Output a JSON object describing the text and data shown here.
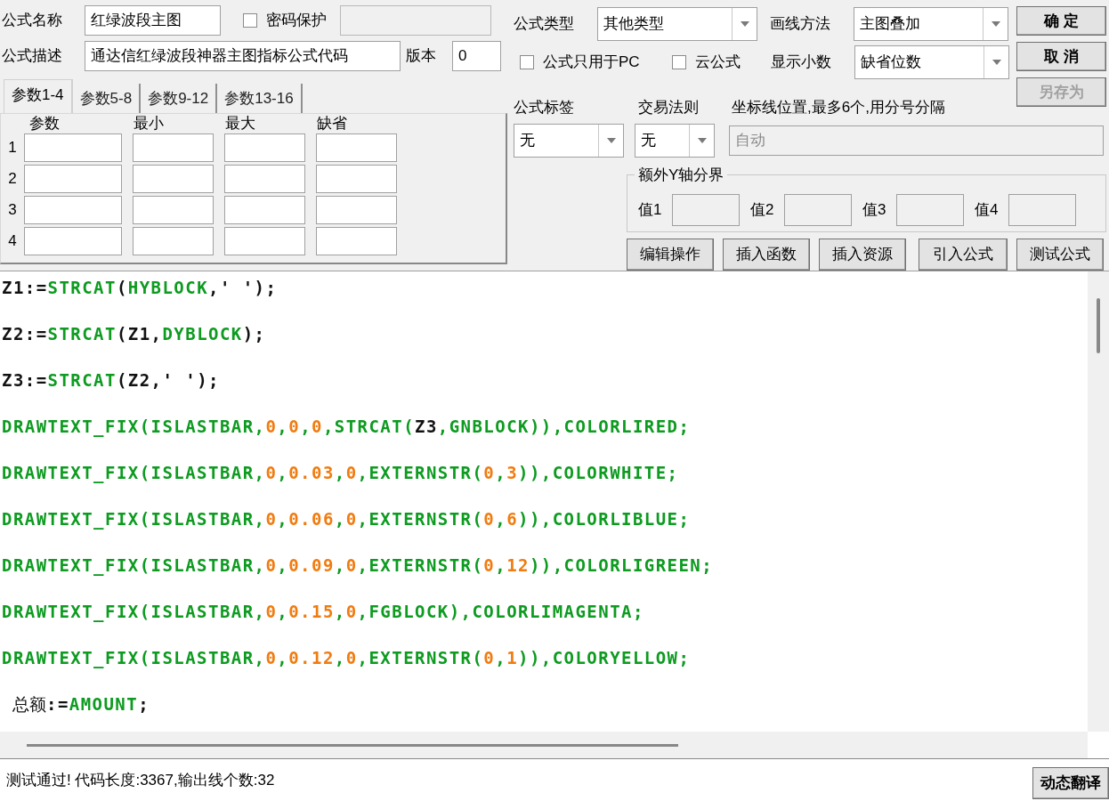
{
  "form": {
    "name_label": "公式名称",
    "name_value": "红绿波段主图",
    "password": {
      "label": "密码保护",
      "checked": false
    },
    "desc_label": "公式描述",
    "desc_value": "通达信红绿波段神器主图指标公式代码",
    "version_label": "版本",
    "version_value": "0"
  },
  "param_tabs": [
    {
      "label": "参数1-4",
      "selected": true
    },
    {
      "label": "参数5-8",
      "selected": false
    },
    {
      "label": "参数9-12",
      "selected": false
    },
    {
      "label": "参数13-16",
      "selected": false
    }
  ],
  "param_columns": [
    "参数",
    "最小",
    "最大",
    "缺省"
  ],
  "param_rows": [
    "1",
    "2",
    "3",
    "4"
  ],
  "formula_type": {
    "label": "公式类型",
    "value": "其他类型"
  },
  "draw_method": {
    "label": "画线方法",
    "value": "主图叠加"
  },
  "options": [
    {
      "label": "公式只用于PC",
      "checked": false
    },
    {
      "label": "云公式",
      "checked": false
    }
  ],
  "decimals": {
    "label": "显示小数",
    "value": "缺省位数"
  },
  "side_buttons": [
    {
      "label": "确 定",
      "disabled": false
    },
    {
      "label": "取 消",
      "disabled": false
    },
    {
      "label": "另存为",
      "disabled": true
    }
  ],
  "tag": {
    "label": "公式标签",
    "value": "无"
  },
  "rule": {
    "label": "交易法则",
    "value": "无"
  },
  "axis": {
    "label": "坐标线位置,最多6个,用分号分隔",
    "value": "自动",
    "disabled": true
  },
  "y_bounds": {
    "title": "额外Y轴分界",
    "values": [
      "值1",
      "值2",
      "值3",
      "值4"
    ]
  },
  "action_buttons": [
    "编辑操作",
    "插入函数",
    "插入资源",
    "引入公式",
    "测试公式"
  ],
  "code_lines": [
    [
      {
        "t": "Z1:=",
        "kind": "plain"
      },
      {
        "t": "STRCAT",
        "kind": "func"
      },
      {
        "t": "(",
        "kind": "plain"
      },
      {
        "t": "HYBLOCK",
        "kind": "func"
      },
      {
        "t": ",' ');",
        "kind": "plain"
      }
    ],
    [
      {
        "t": "Z2:=",
        "kind": "plain"
      },
      {
        "t": "STRCAT",
        "kind": "func"
      },
      {
        "t": "(Z1,",
        "kind": "plain"
      },
      {
        "t": "DYBLOCK",
        "kind": "func"
      },
      {
        "t": ");",
        "kind": "plain"
      }
    ],
    [
      {
        "t": "Z3:=",
        "kind": "plain"
      },
      {
        "t": "STRCAT",
        "kind": "func"
      },
      {
        "t": "(Z2,' ');",
        "kind": "plain"
      }
    ],
    [
      {
        "t": "DRAWTEXT_FIX(ISLASTBAR,",
        "kind": "func"
      },
      {
        "t": "0",
        "kind": "num"
      },
      {
        "t": ",",
        "kind": "func"
      },
      {
        "t": "0",
        "kind": "num"
      },
      {
        "t": ",",
        "kind": "func"
      },
      {
        "t": "0",
        "kind": "num"
      },
      {
        "t": ",STRCAT(",
        "kind": "func"
      },
      {
        "t": "Z3",
        "kind": "plain"
      },
      {
        "t": ",GNBLOCK)),COLORLIRED;",
        "kind": "func"
      }
    ],
    [
      {
        "t": "DRAWTEXT_FIX(ISLASTBAR,",
        "kind": "func"
      },
      {
        "t": "0",
        "kind": "num"
      },
      {
        "t": ",",
        "kind": "func"
      },
      {
        "t": "0.03",
        "kind": "num"
      },
      {
        "t": ",",
        "kind": "func"
      },
      {
        "t": "0",
        "kind": "num"
      },
      {
        "t": ",EXTERNSTR(",
        "kind": "func"
      },
      {
        "t": "0",
        "kind": "num"
      },
      {
        "t": ",",
        "kind": "func"
      },
      {
        "t": "3",
        "kind": "num"
      },
      {
        "t": ")),COLORWHITE;",
        "kind": "func"
      }
    ],
    [
      {
        "t": "DRAWTEXT_FIX(ISLASTBAR,",
        "kind": "func"
      },
      {
        "t": "0",
        "kind": "num"
      },
      {
        "t": ",",
        "kind": "func"
      },
      {
        "t": "0.06",
        "kind": "num"
      },
      {
        "t": ",",
        "kind": "func"
      },
      {
        "t": "0",
        "kind": "num"
      },
      {
        "t": ",EXTERNSTR(",
        "kind": "func"
      },
      {
        "t": "0",
        "kind": "num"
      },
      {
        "t": ",",
        "kind": "func"
      },
      {
        "t": "6",
        "kind": "num"
      },
      {
        "t": ")),COLORLIBLUE;",
        "kind": "func"
      }
    ],
    [
      {
        "t": "DRAWTEXT_FIX(ISLASTBAR,",
        "kind": "func"
      },
      {
        "t": "0",
        "kind": "num"
      },
      {
        "t": ",",
        "kind": "func"
      },
      {
        "t": "0.09",
        "kind": "num"
      },
      {
        "t": ",",
        "kind": "func"
      },
      {
        "t": "0",
        "kind": "num"
      },
      {
        "t": ",EXTERNSTR(",
        "kind": "func"
      },
      {
        "t": "0",
        "kind": "num"
      },
      {
        "t": ",",
        "kind": "func"
      },
      {
        "t": "12",
        "kind": "num"
      },
      {
        "t": ")),COLORLIGREEN;",
        "kind": "func"
      }
    ],
    [
      {
        "t": "DRAWTEXT_FIX(ISLASTBAR,",
        "kind": "func"
      },
      {
        "t": "0",
        "kind": "num"
      },
      {
        "t": ",",
        "kind": "func"
      },
      {
        "t": "0.15",
        "kind": "num"
      },
      {
        "t": ",",
        "kind": "func"
      },
      {
        "t": "0",
        "kind": "num"
      },
      {
        "t": ",FGBLOCK),COLORLIMAGENTA;",
        "kind": "func"
      }
    ],
    [
      {
        "t": "DRAWTEXT_FIX(ISLASTBAR,",
        "kind": "func"
      },
      {
        "t": "0",
        "kind": "num"
      },
      {
        "t": ",",
        "kind": "func"
      },
      {
        "t": "0.12",
        "kind": "num"
      },
      {
        "t": ",",
        "kind": "func"
      },
      {
        "t": "0",
        "kind": "num"
      },
      {
        "t": ",EXTERNSTR(",
        "kind": "func"
      },
      {
        "t": "0",
        "kind": "num"
      },
      {
        "t": ",",
        "kind": "func"
      },
      {
        "t": "1",
        "kind": "num"
      },
      {
        "t": ")),COLORYELLOW;",
        "kind": "func"
      }
    ],
    [
      {
        "t": "总额",
        "kind": "cjk"
      },
      {
        "t": ":=",
        "kind": "plain"
      },
      {
        "t": "AMOUNT",
        "kind": "func"
      },
      {
        "t": ";",
        "kind": "plain"
      }
    ]
  ],
  "status": "测试通过! 代码长度:3367,输出线个数:32",
  "translate_button": "动态翻译"
}
